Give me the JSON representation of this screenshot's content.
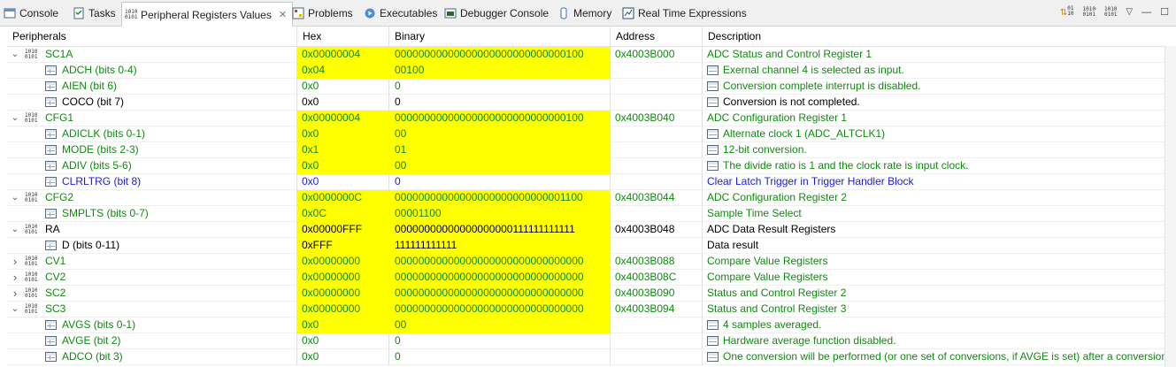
{
  "tabs": [
    {
      "label": "Console",
      "icon": "console-icon"
    },
    {
      "label": "Tasks",
      "icon": "tasks-icon"
    },
    {
      "label": "Peripheral Registers Values",
      "icon": "binary-icon",
      "active": true
    },
    {
      "label": "Problems",
      "icon": "problems-icon"
    },
    {
      "label": "Executables",
      "icon": "executables-icon"
    },
    {
      "label": "Debugger Console",
      "icon": "debugger-console-icon"
    },
    {
      "label": "Memory",
      "icon": "memory-icon"
    },
    {
      "label": "Real Time Expressions",
      "icon": "realtime-icon"
    }
  ],
  "columns": {
    "name": "Peripherals",
    "hex": "Hex",
    "binary": "Binary",
    "address": "Address",
    "description": "Description"
  },
  "rows": [
    {
      "type": "reg",
      "expanded": true,
      "name": "SC1A",
      "hex": "0x00000004",
      "binary": "00000000000000000000000000000100",
      "address": "0x4003B000",
      "description": "ADC Status and Control Register 1",
      "color": "green"
    },
    {
      "type": "field",
      "name": "ADCH (bits 0-4)",
      "hex": "0x04",
      "binary": "00100",
      "description": "Exernal channel 4 is selected as input.",
      "color": "green",
      "hl": true,
      "desc_icon": true
    },
    {
      "type": "field",
      "name": "AIEN (bit 6)",
      "hex": "0x0",
      "binary": "0",
      "description": "Conversion complete interrupt is disabled.",
      "color": "green",
      "desc_icon": true
    },
    {
      "type": "field",
      "name": "COCO (bit 7)",
      "hex": "0x0",
      "binary": "0",
      "description": "Conversion is not completed.",
      "color": "black",
      "desc_icon": true
    },
    {
      "type": "reg",
      "expanded": true,
      "name": "CFG1",
      "hex": "0x00000004",
      "binary": "00000000000000000000000000000100",
      "address": "0x4003B040",
      "description": "ADC Configuration Register 1",
      "color": "green"
    },
    {
      "type": "field",
      "name": "ADICLK (bits 0-1)",
      "hex": "0x0",
      "binary": "00",
      "description": "Alternate clock 1 (ADC_ALTCLK1)",
      "color": "green",
      "hl": true,
      "desc_icon": true
    },
    {
      "type": "field",
      "name": "MODE (bits 2-3)",
      "hex": "0x1",
      "binary": "01",
      "description": "12-bit conversion.",
      "color": "green",
      "hl": true,
      "desc_icon": true
    },
    {
      "type": "field",
      "name": "ADIV (bits 5-6)",
      "hex": "0x0",
      "binary": "00",
      "description": "The divide ratio is 1 and the clock rate is input clock.",
      "color": "green",
      "hl": true,
      "desc_icon": true
    },
    {
      "type": "field",
      "name": "CLRLTRG (bit 8)",
      "hex": "0x0",
      "binary": "0",
      "description": "Clear Latch Trigger in Trigger Handler Block",
      "color": "blue"
    },
    {
      "type": "reg",
      "expanded": true,
      "name": "CFG2",
      "hex": "0x0000000C",
      "binary": "00000000000000000000000000001100",
      "address": "0x4003B044",
      "description": "ADC Configuration Register 2",
      "color": "green"
    },
    {
      "type": "field",
      "name": "SMPLTS (bits 0-7)",
      "hex": "0x0C",
      "binary": "00001100",
      "description": "Sample Time Select",
      "color": "green",
      "hl": true
    },
    {
      "type": "reg",
      "expanded": true,
      "name": "RA",
      "hex": "0x00000FFF",
      "binary": "00000000000000000000111111111111",
      "address": "0x4003B048",
      "description": "ADC Data Result Registers",
      "color": "black"
    },
    {
      "type": "field",
      "name": "D (bits 0-11)",
      "hex": "0xFFF",
      "binary": "111111111111",
      "description": "Data result",
      "color": "black",
      "hl": true
    },
    {
      "type": "reg",
      "expanded": false,
      "name": "CV1",
      "hex": "0x00000000",
      "binary": "00000000000000000000000000000000",
      "address": "0x4003B088",
      "description": "Compare Value Registers",
      "color": "green"
    },
    {
      "type": "reg",
      "expanded": false,
      "name": "CV2",
      "hex": "0x00000000",
      "binary": "00000000000000000000000000000000",
      "address": "0x4003B08C",
      "description": "Compare Value Registers",
      "color": "green"
    },
    {
      "type": "reg",
      "expanded": false,
      "name": "SC2",
      "hex": "0x00000000",
      "binary": "00000000000000000000000000000000",
      "address": "0x4003B090",
      "description": "Status and Control Register 2",
      "color": "green"
    },
    {
      "type": "reg",
      "expanded": true,
      "name": "SC3",
      "hex": "0x00000000",
      "binary": "00000000000000000000000000000000",
      "address": "0x4003B094",
      "description": "Status and Control Register 3",
      "color": "green"
    },
    {
      "type": "field",
      "name": "AVGS (bits 0-1)",
      "hex": "0x0",
      "binary": "00",
      "description": "4 samples averaged.",
      "color": "green",
      "hl": true,
      "desc_icon": true
    },
    {
      "type": "field",
      "name": "AVGE (bit 2)",
      "hex": "0x0",
      "binary": "0",
      "description": "Hardware average function disabled.",
      "color": "green",
      "desc_icon": true
    },
    {
      "type": "field",
      "name": "ADCO (bit 3)",
      "hex": "0x0",
      "binary": "0",
      "description": "One conversion will be performed (or one set of conversions, if AVGE is set) after a conversion...",
      "color": "green",
      "desc_icon": true
    }
  ],
  "colors": {
    "highlight": "#ffff00",
    "green": "#118a11",
    "blue": "#1b1be0"
  }
}
